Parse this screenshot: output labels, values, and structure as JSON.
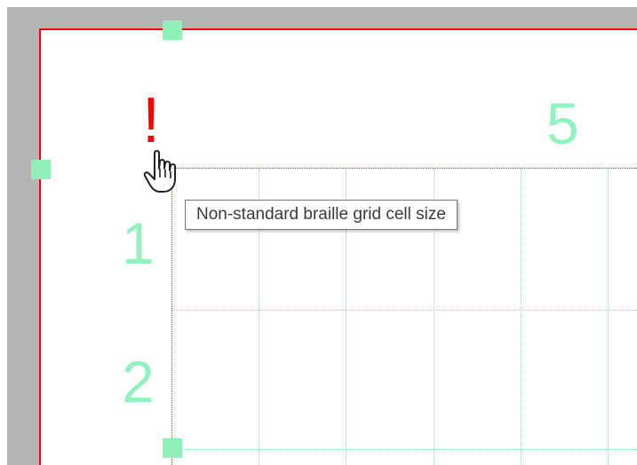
{
  "labels": {
    "warning_symbol": "!",
    "row_1": "1",
    "row_2": "2",
    "column_5": "5"
  },
  "tooltip": {
    "text": "Non-standard braille grid cell size"
  },
  "cursor": {
    "icon": "hand-pointer-icon"
  },
  "colors": {
    "page_border": "#ff0000",
    "grid_border": "#ff2a2a",
    "grid_lines": "#8be8b0",
    "labels": "#92f2bd",
    "handles": "#8ff0b8",
    "warning": "#ff0000",
    "backdrop": "#b4b4b4"
  }
}
